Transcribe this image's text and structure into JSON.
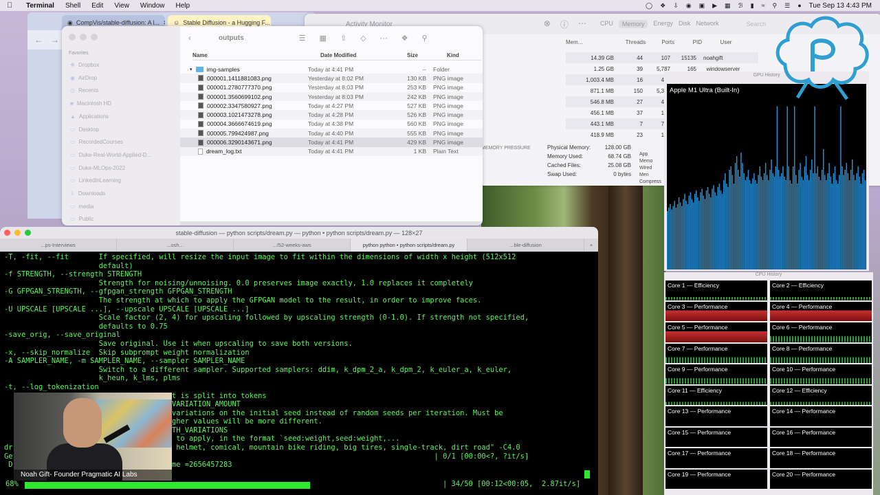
{
  "menubar": {
    "app": "Terminal",
    "items": [
      "Shell",
      "Edit",
      "View",
      "Window",
      "Help"
    ],
    "clock": "Tue Sep 13  4:43 PM"
  },
  "browser": {
    "tabs": [
      {
        "label": "CompVis/stable-diffusion: A l..."
      },
      {
        "label": "Stable Diffusion - a Hugging F..."
      }
    ]
  },
  "activity_monitor": {
    "title": "Activity Monitor",
    "tabs": [
      "CPU",
      "Memory",
      "Energy",
      "Disk",
      "Network"
    ],
    "selected_tab": "Memory",
    "search_placeholder": "Search",
    "columns": [
      "Mem...",
      "Threads",
      "Ports",
      "PID",
      "User"
    ],
    "rows": [
      {
        "mem": "14.39 GB",
        "threads": "44",
        "ports": "107",
        "pid": "15135",
        "user": "noahgift"
      },
      {
        "mem": "1.25 GB",
        "threads": "39",
        "ports": "5,787",
        "pid": "165",
        "user": "_windowserver"
      },
      {
        "mem": "1,003.4 MB",
        "threads": "16",
        "ports": "499",
        "pid": "",
        "user": ""
      },
      {
        "mem": "871.1 MB",
        "threads": "150",
        "ports": "5,310",
        "pid": "",
        "user": ""
      },
      {
        "mem": "546.8 MB",
        "threads": "27",
        "ports": "439",
        "pid": "",
        "user": ""
      },
      {
        "mem": "456.1 MB",
        "threads": "37",
        "ports": "159",
        "pid": "",
        "user": ""
      },
      {
        "mem": "443.1 MB",
        "threads": "7",
        "ports": "753",
        "pid": "",
        "user": ""
      },
      {
        "mem": "418.9 MB",
        "threads": "23",
        "ports": "199",
        "pid": "",
        "user": ""
      }
    ],
    "memory_pressure_label": "MEMORY PRESSURE",
    "stats": [
      {
        "label": "Physical Memory:",
        "value": "128.00 GB"
      },
      {
        "label": "Memory Used:",
        "value": "68.74 GB"
      },
      {
        "label": "Cached Files:",
        "value": "25.08 GB"
      },
      {
        "label": "Swap Used:",
        "value": "0 bytes"
      }
    ],
    "side_labels": [
      "App Memo",
      "Wired Men",
      "Compress"
    ]
  },
  "finder": {
    "title": "outputs",
    "favorites_label": "Favorites",
    "sidebar": [
      "Dropbox",
      "AirDrop",
      "Recents",
      "Macintosh HD",
      "Applications",
      "Desktop",
      "RecordedCourses",
      "Duke-Real-World-Applied-D...",
      "Duke-MLOps-2022",
      "LinkedInLearning",
      "Downloads",
      "media",
      "Public"
    ],
    "columns": {
      "name": "Name",
      "date": "Date Modified",
      "size": "Size",
      "kind": "Kind"
    },
    "files": [
      {
        "name": "img-samples",
        "date": "Today at 4:41 PM",
        "size": "--",
        "kind": "Folder",
        "type": "folder"
      },
      {
        "name": "000001.1411881083.png",
        "date": "Yesterday at 8:02 PM",
        "size": "130 KB",
        "kind": "PNG image",
        "type": "img"
      },
      {
        "name": "000001.2780777370.png",
        "date": "Yesterday at 8:03 PM",
        "size": "253 KB",
        "kind": "PNG image",
        "type": "img"
      },
      {
        "name": "000001.3560699102.png",
        "date": "Yesterday at 8:03 PM",
        "size": "242 KB",
        "kind": "PNG image",
        "type": "img"
      },
      {
        "name": "000002.3347580927.png",
        "date": "Today at 4:27 PM",
        "size": "527 KB",
        "kind": "PNG image",
        "type": "img"
      },
      {
        "name": "000003.1021473278.png",
        "date": "Today at 4:28 PM",
        "size": "526 KB",
        "kind": "PNG image",
        "type": "img"
      },
      {
        "name": "000004.3666674619.png",
        "date": "Today at 4:38 PM",
        "size": "560 KB",
        "kind": "PNG image",
        "type": "img"
      },
      {
        "name": "000005.799424987.png",
        "date": "Today at 4:40 PM",
        "size": "555 KB",
        "kind": "PNG image",
        "type": "img"
      },
      {
        "name": "000006.3290143671.png",
        "date": "Today at 4:41 PM",
        "size": "429 KB",
        "kind": "PNG image",
        "type": "img",
        "selected": true
      },
      {
        "name": "dream_log.txt",
        "date": "Today at 4:41 PM",
        "size": "1 KB",
        "kind": "Plain Text",
        "type": "doc"
      }
    ]
  },
  "gpu": {
    "title": "GPU History",
    "device": "Apple M1 Ultra (Built-In)",
    "history": [
      0.34,
      0.36,
      0.38,
      0.35,
      0.37,
      0.4,
      0.36,
      0.38,
      0.42,
      0.39,
      0.37,
      0.41,
      0.44,
      0.4,
      0.38,
      0.43,
      0.45,
      0.41,
      0.39,
      0.44,
      0.46,
      0.42,
      0.4,
      0.45,
      0.47,
      0.43,
      0.41,
      0.46,
      0.48,
      0.44,
      0.42,
      0.47,
      0.49,
      0.45,
      0.43,
      0.48,
      0.5,
      0.46,
      0.44,
      0.52,
      0.56,
      0.5,
      0.48,
      0.58,
      0.6,
      0.55,
      0.5,
      0.62,
      0.66,
      0.58,
      0.54,
      0.68,
      0.62,
      0.56,
      0.52,
      0.54,
      0.58,
      0.52,
      0.5,
      0.53,
      0.56,
      0.52,
      0.5,
      0.55,
      0.6,
      0.54,
      0.52,
      0.56,
      0.62,
      0.55,
      0.52,
      0.58,
      0.64,
      0.56,
      0.54,
      0.6,
      0.95,
      0.58,
      0.54,
      0.56,
      0.6,
      0.54,
      0.52,
      0.95,
      0.6,
      0.52,
      0.5,
      0.6,
      0.95,
      0.55,
      0.5,
      0.58,
      0.62,
      0.54,
      0.52,
      0.6,
      0.66,
      0.55,
      0.52,
      0.58,
      0.64,
      0.56,
      0.95,
      0.56,
      0.6,
      0.54,
      0.52,
      0.58,
      0.7,
      0.55,
      0.52,
      0.56,
      0.62,
      0.54,
      0.5,
      0.56,
      0.6,
      0.52,
      0.5,
      0.55,
      0.95,
      0.6,
      0.55,
      0.58,
      0.62,
      0.56,
      0.52,
      0.58,
      0.64,
      0.55,
      0.52,
      0.56,
      0.6,
      0.54,
      0.5,
      0.56,
      0.58,
      0.52
    ]
  },
  "cpu": {
    "title": "CPU History",
    "cores": [
      {
        "label": "Core 1 — Efficiency",
        "load": "low"
      },
      {
        "label": "Core 2 — Efficiency",
        "load": "low"
      },
      {
        "label": "Core 3 — Performance",
        "load": "hot"
      },
      {
        "label": "Core 4 — Performance",
        "load": "hot"
      },
      {
        "label": "Core 5 — Performance",
        "load": "hot"
      },
      {
        "label": "Core 6 — Performance",
        "load": "warm"
      },
      {
        "label": "Core 7 — Performance",
        "load": "warm"
      },
      {
        "label": "Core 8 — Performance",
        "load": "warm"
      },
      {
        "label": "Core 9 — Performance",
        "load": "warm"
      },
      {
        "label": "Core 10 — Performance",
        "load": "warm"
      },
      {
        "label": "Core 11 — Efficiency",
        "load": "low"
      },
      {
        "label": "Core 12 — Efficiency",
        "load": "low"
      },
      {
        "label": "Core 13 — Performance",
        "load": "none"
      },
      {
        "label": "Core 14 — Performance",
        "load": "none"
      },
      {
        "label": "Core 15 — Performance",
        "load": "none"
      },
      {
        "label": "Core 16 — Performance",
        "load": "none"
      },
      {
        "label": "Core 17 — Performance",
        "load": "none"
      },
      {
        "label": "Core 18 — Performance",
        "load": "none"
      },
      {
        "label": "Core 19 — Performance",
        "load": "none"
      },
      {
        "label": "Core 20 — Performance",
        "load": "none"
      }
    ]
  },
  "terminal": {
    "title": "stable-diffusion — python scripts/dream.py — python • python scripts/dream.py — 128×27",
    "tabs": [
      "...ps-Interviews",
      "...osh...",
      ".../52-weeks-aws",
      "python  python • python scripts/dream.py",
      "...ble-diffusion"
    ],
    "output": "-T, -fit, --fit       If specified, will resize the input image to fit within the dimensions of width x height (512x512\n                      default)\n-f STRENGTH, --strength STRENGTH\n                      Strength for noising/unnoising. 0.0 preserves image exactly, 1.0 replaces it completely\n-G GFPGAN_STRENGTH, --gfpgan_strength GFPGAN_STRENGTH\n                      The strength at which to apply the GFPGAN model to the result, in order to improve faces.\n-U UPSCALE [UPSCALE ...], --upscale UPSCALE [UPSCALE ...]\n                      Scale factor (2, 4) for upscaling followed by upscaling strength (0-1.0). If strength not specified,\n                      defaults to 0.75\n-save_orig, --save_original\n                      Save original. Use it when upscaling to save both versions.\n-x, --skip_normalize  Skip subprompt weight normalization\n-A SAMPLER_NAME, -m SAMPLER_NAME, --sampler SAMPLER_NAME\n                      Switch to a different sampler. Supported samplers: ddim, k_dpm_2_a, k_dpm_2, k_euler_a, k_euler,\n                      k_heun, k_lms, plms\n-t, --log_tokenization\n                                  prompt is split into tokens\n                                  ount VARIATION_AMOUNT\n                                  ates variations on the initial seed instead of random seeds per iteration. Must be\n                                  1. Higher values will be more different.\n                                  ns WITH_VARIATIONS\n                                  tions to apply, in the format `seed:weight,seed:weight,...\ndr                                black helmet, comical, mountain bike riding, big tires, single-track, dirt road\" -C4.0\nGe                                                                                                  | 0/1 [00:00<?, ?it/s]\n D                                on time =2656457283",
    "progress_pct": "68%",
    "progress_fraction": 0.68,
    "progress_text": "| 34/50 [00:12<00:05,  2.87it/s]"
  },
  "webcam": {
    "caption": "Noah Gift- Founder Pragmatic AI Labs"
  }
}
